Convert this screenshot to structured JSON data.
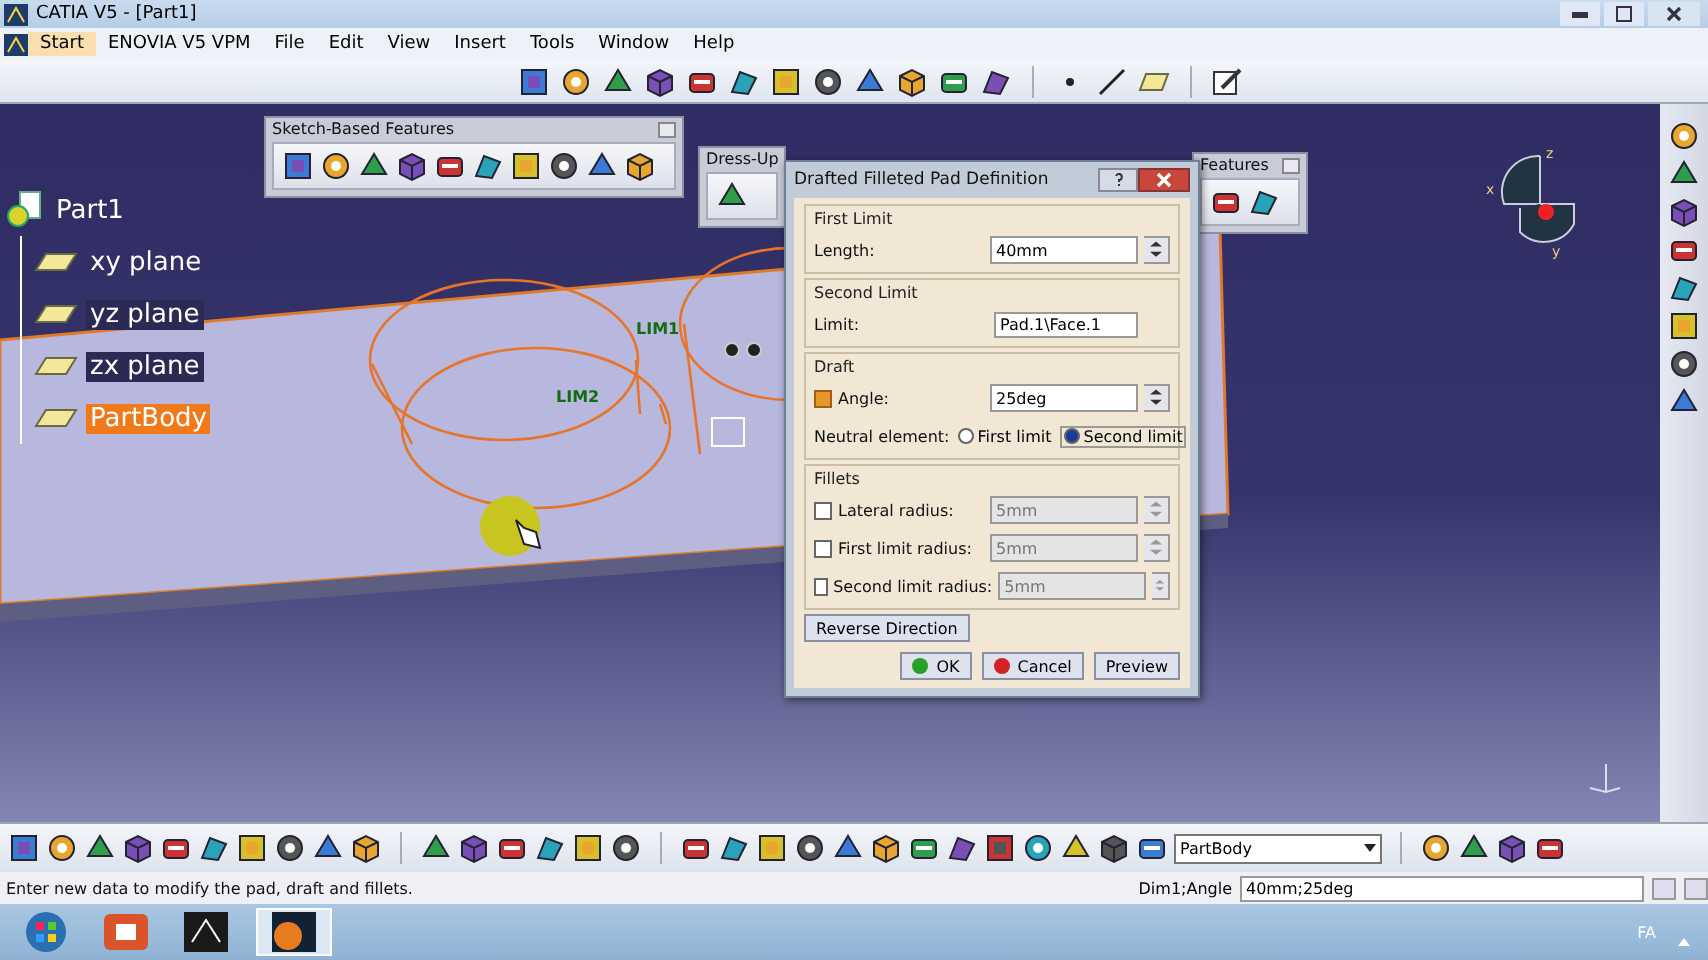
{
  "window": {
    "title": "CATIA V5 - [Part1]"
  },
  "menu": [
    {
      "label": "Start",
      "selected": true
    },
    {
      "label": "ENOVIA V5 VPM",
      "selected": false
    },
    {
      "label": "File",
      "selected": false
    },
    {
      "label": "Edit",
      "selected": false
    },
    {
      "label": "View",
      "selected": false
    },
    {
      "label": "Insert",
      "selected": false
    },
    {
      "label": "Tools",
      "selected": false
    },
    {
      "label": "Window",
      "selected": false
    },
    {
      "label": "Help",
      "selected": false
    }
  ],
  "floating_toolbars": [
    {
      "title": "Sketch-Based Features"
    },
    {
      "title": "Dress-Up"
    },
    {
      "title": "Features"
    }
  ],
  "tree": [
    {
      "label": "Part1",
      "selected": false,
      "highlighted": false,
      "children": [
        {
          "label": "xy plane",
          "selected": false,
          "highlighted": false
        },
        {
          "label": "yz plane",
          "selected": false,
          "highlighted": true
        },
        {
          "label": "zx plane",
          "selected": false,
          "highlighted": true
        },
        {
          "label": "PartBody",
          "selected": true,
          "highlighted": false
        }
      ]
    }
  ],
  "sketch_labels": [
    "LIM1",
    "LIM2"
  ],
  "compass": {
    "labels": [
      "z",
      "x",
      "y"
    ]
  },
  "dialog": {
    "title": "Drafted Filleted Pad Definition",
    "first_limit": {
      "heading": "First Limit",
      "label": "Length:",
      "value": "40mm"
    },
    "second_limit": {
      "heading": "Second Limit",
      "label": "Limit:",
      "value": "Pad.1\\Face.1"
    },
    "draft": {
      "heading": "Draft",
      "angle_label": "Angle:",
      "checked": true,
      "angle": "25deg",
      "neutral_label": "Neutral element:",
      "options": [
        {
          "label": "First limit",
          "selected": false
        },
        {
          "label": "Second limit",
          "selected": true
        }
      ]
    },
    "fillets": {
      "heading": "Fillets",
      "rows": [
        {
          "label": "Lateral radius:",
          "checked": false,
          "value": "5mm"
        },
        {
          "label": "First limit radius:",
          "checked": false,
          "value": "5mm"
        },
        {
          "label": "Second limit radius:",
          "checked": false,
          "value": "5mm"
        }
      ]
    },
    "reverse": "Reverse Direction",
    "buttons": [
      {
        "label": "OK",
        "kind": "ok"
      },
      {
        "label": "Cancel",
        "kind": "cancel"
      },
      {
        "label": "Preview",
        "kind": "plain"
      }
    ]
  },
  "body_selector": {
    "value": "PartBody"
  },
  "status_bar": {
    "message": "Enter new data to modify the pad, draft and fillets.",
    "prompt": "Dim1;Angle",
    "value": "40mm;25deg"
  },
  "taskbar": {
    "language": "FA"
  }
}
